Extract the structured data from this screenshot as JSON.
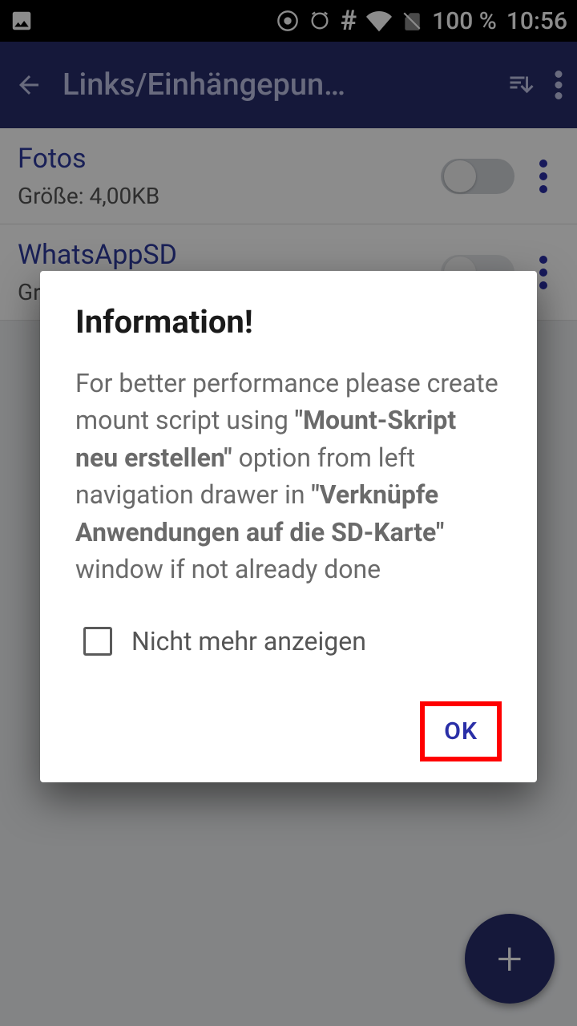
{
  "status": {
    "battery": "100 %",
    "time": "10:56"
  },
  "appbar": {
    "title": "Links/Einhängepun…"
  },
  "rows": [
    {
      "name": "Fotos",
      "size": "Größe: 4,00KB"
    },
    {
      "name": "WhatsAppSD",
      "size": "Gr"
    }
  ],
  "dialog": {
    "title": "Information!",
    "body_1": "For better performance please create mount script using ",
    "bold_1": "\"Mount-Skript neu erstellen\"",
    "body_2": " option from left navigation drawer in ",
    "bold_2": "\"Verknüpfe Anwendungen auf die SD-Karte\"",
    "body_3": " window if not already done",
    "checkbox_label": "Nicht mehr anzeigen",
    "ok": "OK"
  },
  "fab": "+"
}
